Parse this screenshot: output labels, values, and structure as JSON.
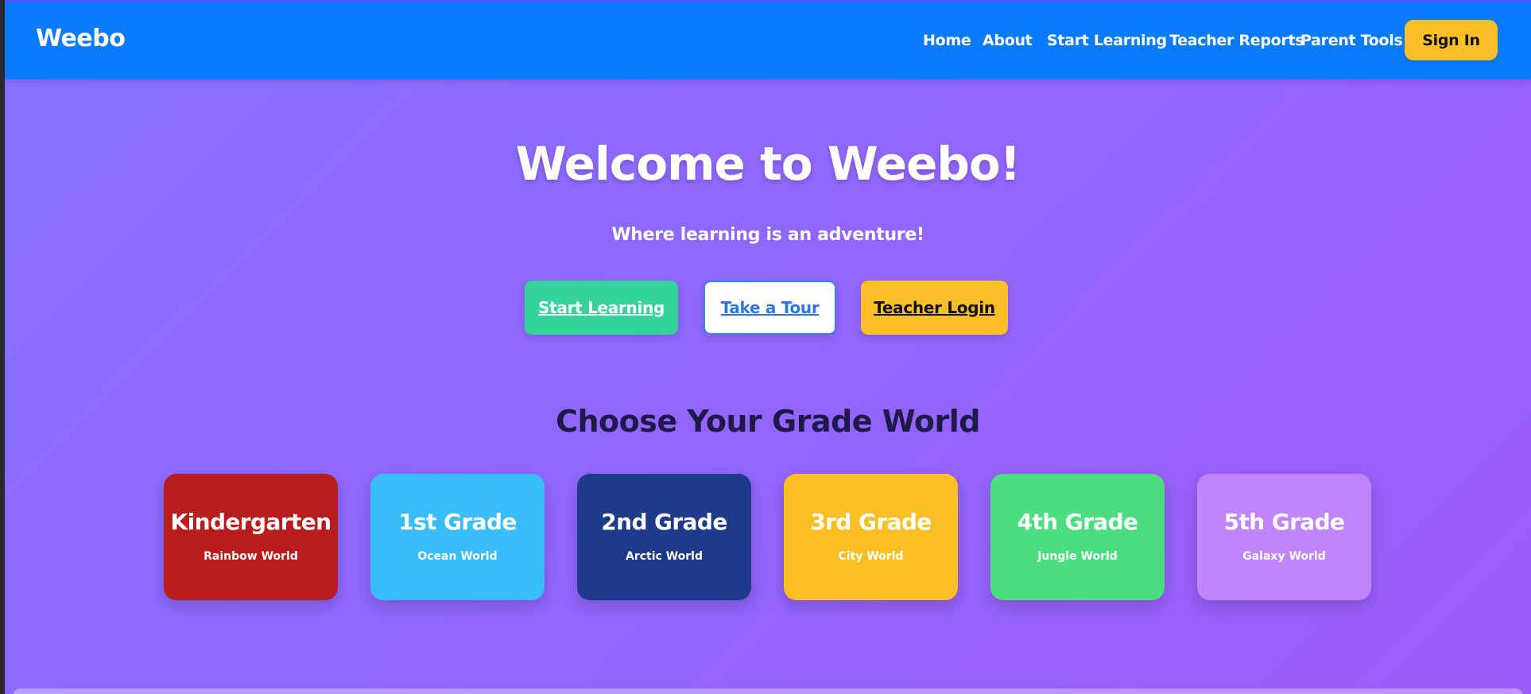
{
  "brand": {
    "name": "Weebo"
  },
  "nav": {
    "items": [
      {
        "label": "Home"
      },
      {
        "label": "About"
      },
      {
        "label": "Start Learning"
      },
      {
        "label": "Teacher Reports"
      },
      {
        "label": "Parent Tools"
      }
    ],
    "sign_in_label": "Sign In"
  },
  "hero": {
    "title": "Welcome to Weebo!",
    "subtitle": "Where learning is an adventure!",
    "buttons": {
      "start_learning": "Start Learning",
      "take_tour": "Take a Tour",
      "teacher_login": "Teacher Login"
    }
  },
  "grades": {
    "title": "Choose Your Grade World",
    "items": [
      {
        "name": "Kindergarten",
        "world": "Rainbow World",
        "color": "#b91c1c"
      },
      {
        "name": "1st Grade",
        "world": "Ocean World",
        "color": "#38bdf8"
      },
      {
        "name": "2nd Grade",
        "world": "Arctic World",
        "color": "#1e3a8a"
      },
      {
        "name": "3rd Grade",
        "world": "City World",
        "color": "#fbbf24"
      },
      {
        "name": "4th Grade",
        "world": "Jungle World",
        "color": "#4ade80"
      },
      {
        "name": "5th Grade",
        "world": "Galaxy World",
        "color": "#c084fc"
      }
    ]
  },
  "theme": {
    "navbar": "#0a7bff",
    "accent_yellow": "#fbc028",
    "accent_green": "#34d399",
    "page_gradient": [
      "#8670fe",
      "#9b5cf8"
    ]
  }
}
